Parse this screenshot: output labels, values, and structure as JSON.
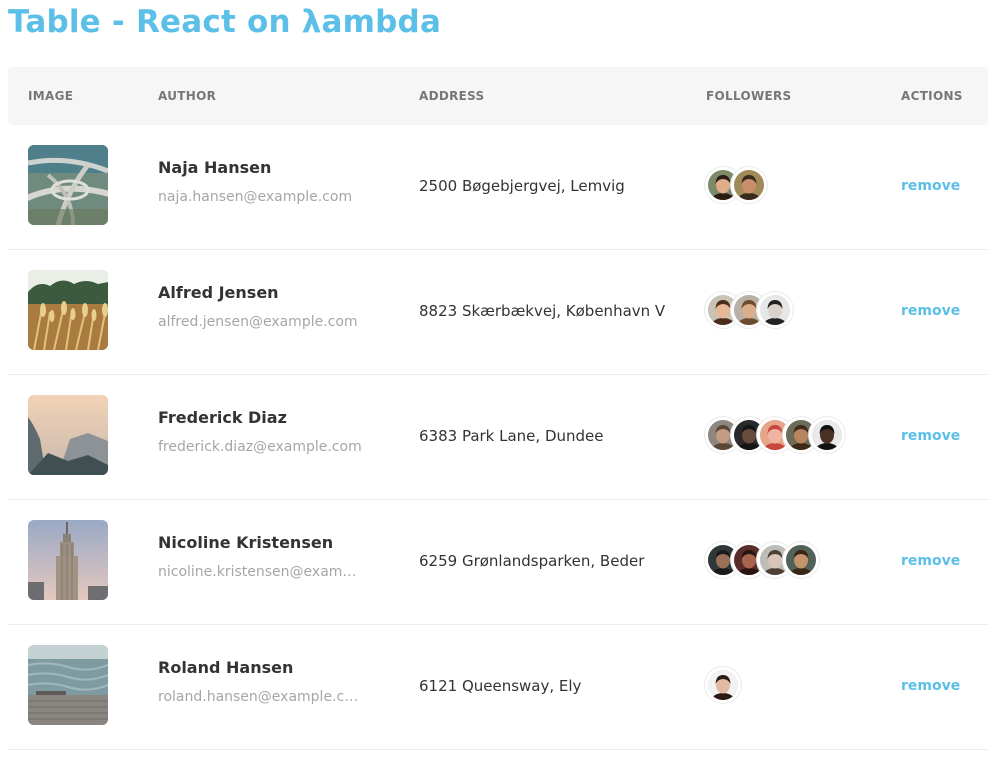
{
  "page": {
    "title": "Table - React on λambda"
  },
  "table": {
    "columns": [
      "IMAGE",
      "AUTHOR",
      "ADDRESS",
      "FOLLOWERS",
      "ACTIONS"
    ],
    "rows": [
      {
        "author": "Naja Hansen",
        "email": "naja.hansen@example.com",
        "address": "2500 Bøgebjergvej, Lemvig",
        "image": "highway-interchange-image",
        "followers": [
          {
            "skin": "#e0ac8a",
            "hair": "#2b1d14",
            "bg": "#7d8a6a"
          },
          {
            "skin": "#c98f6a",
            "hair": "#3a2a1c",
            "bg": "#a08a58"
          }
        ],
        "action": "remove"
      },
      {
        "author": "Alfred Jensen",
        "email": "alfred.jensen@example.com",
        "address": "8823 Skærbækvej, København V",
        "image": "wheat-field-image",
        "followers": [
          {
            "skin": "#e8b896",
            "hair": "#4a2c1a",
            "bg": "#c9c3b5"
          },
          {
            "skin": "#dcae8c",
            "hair": "#6b4b2e",
            "bg": "#b8b0a4"
          },
          {
            "skin": "#d9d2cc",
            "hair": "#222222",
            "bg": "#e7e7e7"
          }
        ],
        "action": "remove"
      },
      {
        "author": "Frederick Diaz",
        "email": "frederick.diaz@example.com",
        "address": "6383 Park Lane, Dundee",
        "image": "mountain-valley-image",
        "followers": [
          {
            "skin": "#c59b84",
            "hair": "#5b4738",
            "bg": "#8e877f"
          },
          {
            "skin": "#6a4c3c",
            "hair": "#151515",
            "bg": "#2a2a2a"
          },
          {
            "skin": "#f0b5a2",
            "hair": "#c7463e",
            "bg": "#e7a489"
          },
          {
            "skin": "#b98560",
            "hair": "#3e2a18",
            "bg": "#6d6b5a"
          },
          {
            "skin": "#4a3026",
            "hair": "#111111",
            "bg": "#e9e9e9"
          }
        ],
        "action": "remove"
      },
      {
        "author": "Nicoline Kristensen",
        "email": "nicoline.kristensen@example.com",
        "address": "6259 Grønlandsparken, Beder",
        "image": "skyscraper-image",
        "followers": [
          {
            "skin": "#9a7058",
            "hair": "#1a1a1a",
            "bg": "#2f3838"
          },
          {
            "skin": "#a8654e",
            "hair": "#2a1410",
            "bg": "#5a2d2a"
          },
          {
            "skin": "#d8c4b8",
            "hair": "#4c4036",
            "bg": "#bdbdb8"
          },
          {
            "skin": "#c4936c",
            "hair": "#3a2614",
            "bg": "#52615a"
          }
        ],
        "action": "remove"
      },
      {
        "author": "Roland Hansen",
        "email": "roland.hansen@example.com",
        "address": "6121 Queensway, Ely",
        "image": "pier-sea-image",
        "followers": [
          {
            "skin": "#e2b9a2",
            "hair": "#2a1a14",
            "bg": "#f2f2f2"
          }
        ],
        "action": "remove"
      }
    ]
  }
}
